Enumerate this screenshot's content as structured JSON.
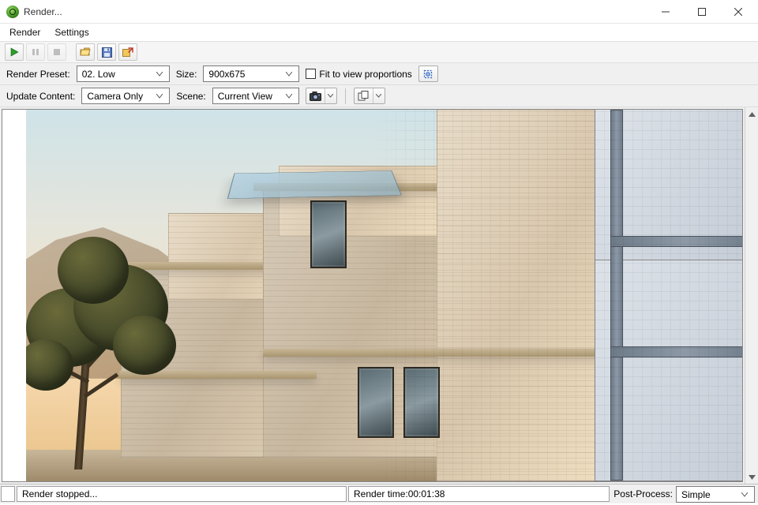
{
  "window": {
    "title": "Render..."
  },
  "menu": {
    "render": "Render",
    "settings": "Settings"
  },
  "row1": {
    "preset_label": "Render Preset:",
    "preset_value": "02. Low",
    "size_label": "Size:",
    "size_value": "900x675",
    "fit_label": "Fit to view proportions"
  },
  "row2": {
    "update_label": "Update Content:",
    "update_value": "Camera Only",
    "scene_label": "Scene:",
    "scene_value": "Current View"
  },
  "status": {
    "left_msg": "Render stopped...",
    "time_label": "Render time: ",
    "time_value": "00:01:38",
    "pp_label": "Post-Process:",
    "pp_value": "Simple"
  }
}
